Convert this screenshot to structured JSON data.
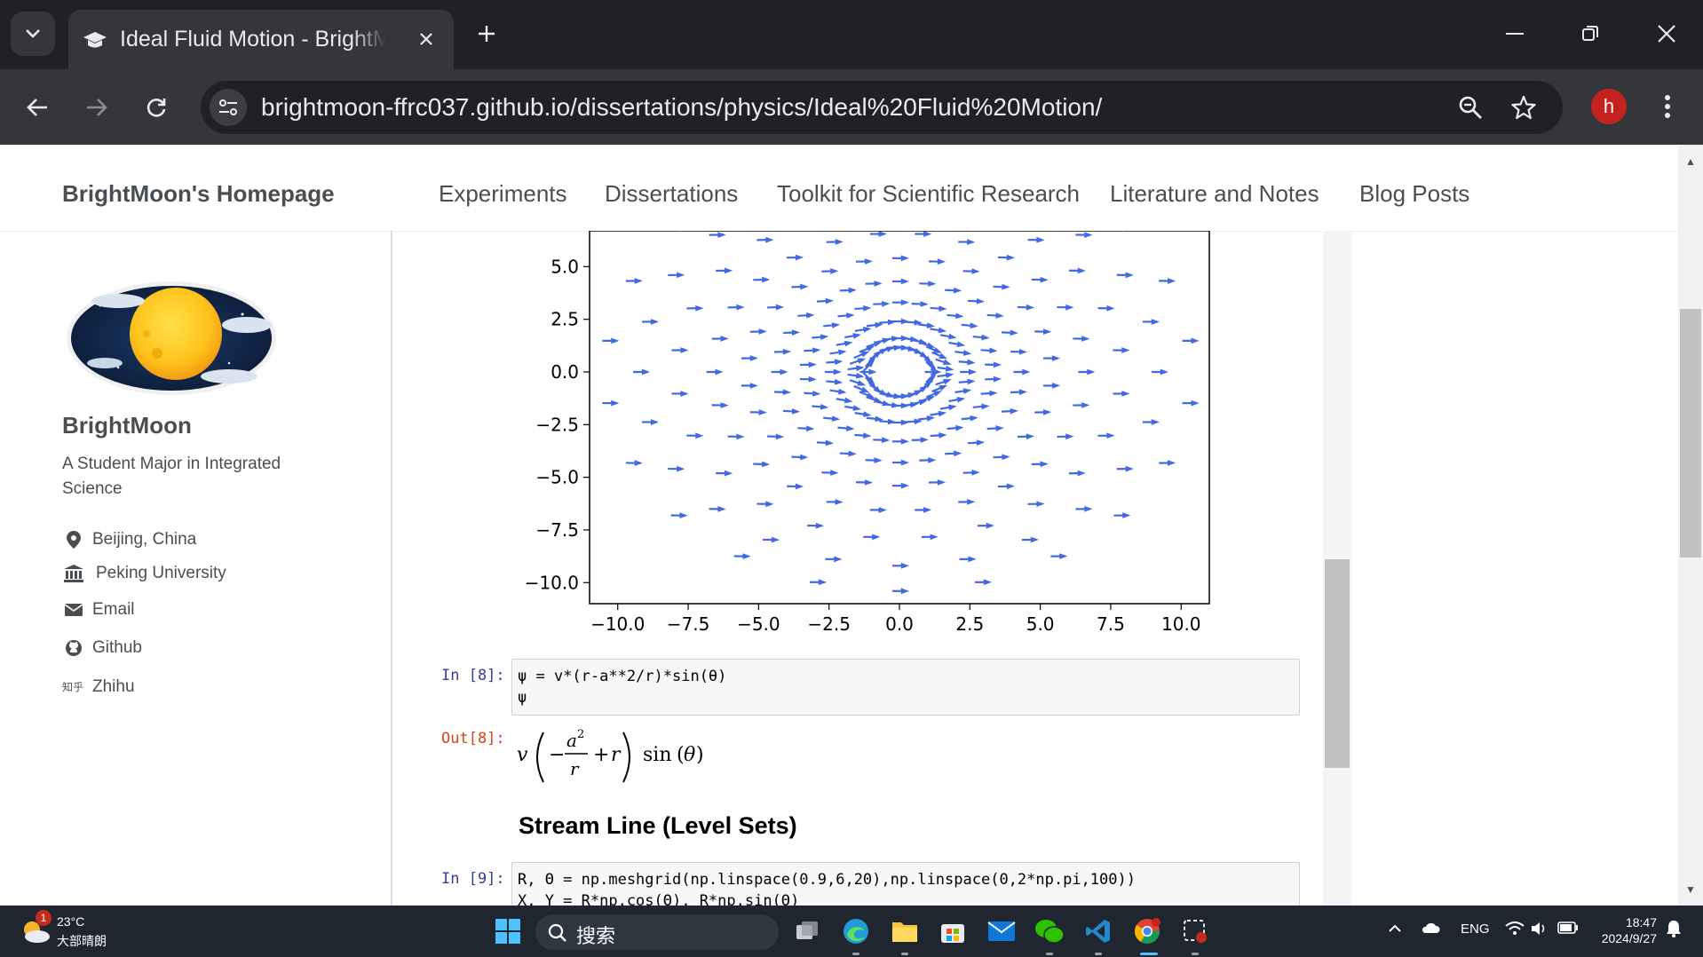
{
  "browser": {
    "tab_title": "Ideal Fluid Motion - BrightMoon's Homepage",
    "url": "brightmoon-ffrc037.github.io/dissertations/physics/Ideal%20Fluid%20Motion/",
    "avatar_letter": "h"
  },
  "site": {
    "brand": "BrightMoon's Homepage",
    "nav": [
      "Experiments",
      "Dissertations",
      "Toolkit for Scientific Research",
      "Literature and Notes",
      "Blog Posts"
    ]
  },
  "sidebar": {
    "name": "BrightMoon",
    "bio": "A Student Major in Integrated Science",
    "items": [
      {
        "icon": "location-pin-icon",
        "label": "Beijing, China"
      },
      {
        "icon": "university-icon",
        "label": "Peking University"
      },
      {
        "icon": "envelope-icon",
        "label": "Email"
      },
      {
        "icon": "github-icon",
        "label": "Github"
      },
      {
        "icon": "zhihu-icon",
        "label": "Zhihu",
        "icon_text": "知乎"
      }
    ]
  },
  "chart_data": {
    "type": "quiver",
    "x_ticks": [
      "−10.0",
      "−7.5",
      "−5.0",
      "−2.5",
      "0.0",
      "2.5",
      "5.0",
      "7.5",
      "10.0"
    ],
    "y_ticks": [
      "5.0",
      "2.5",
      "0.0",
      "−2.5",
      "−5.0",
      "−7.5",
      "−10.0"
    ],
    "xlim": [
      -11,
      11
    ],
    "ylim": [
      -11,
      6.7
    ],
    "arrow_color": "#4169e1",
    "description_of_field": "uniform flow past a cylinder (polar grid of arrows, concentric rings)"
  },
  "cells": {
    "in8_prompt": "In [8]:",
    "in8_line1": "ψ = v*(r-a**2/r)*sin(θ)",
    "in8_line2": "ψ",
    "out8_prompt": "Out[8]:",
    "section_title": "Stream Line (Level Sets)",
    "in9_prompt": "In [9]:",
    "in9_line1": "R, Θ = np.meshgrid(np.linspace(0.9,6,20),np.linspace(0,2*np.pi,100))",
    "in9_line2": "X, Y = R*np.cos(Θ), R*np.sin(Θ)"
  },
  "taskbar": {
    "weather_temp": "23°C",
    "weather_desc": "大部晴朗",
    "weather_badge": "1",
    "search_placeholder": "搜索",
    "lang": "ENG",
    "time": "18:47",
    "date": "2024/9/27"
  }
}
